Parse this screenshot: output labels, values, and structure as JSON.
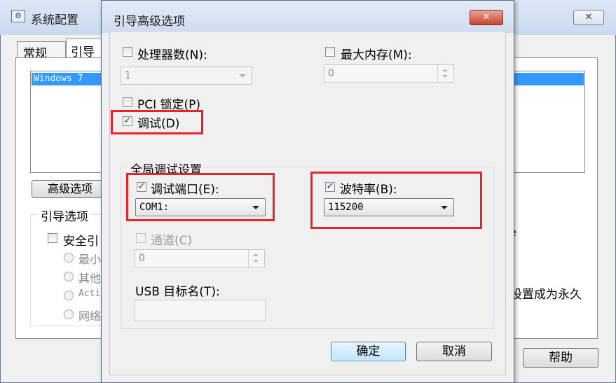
{
  "background_window": {
    "title": "系统配置",
    "close_label": "✕",
    "tabs": [
      "常规",
      "引导"
    ],
    "list_items": [
      "Windows 7"
    ],
    "advanced_button": "高级选项",
    "boot_options_group": "引导选项",
    "safe_boot_label": "安全引",
    "radio_labels": [
      "最小",
      "其他",
      "Acti",
      "网络"
    ],
    "right_fragment": "e",
    "right_text": "设置成为永久",
    "help_button": "帮助"
  },
  "dialog": {
    "title": "引导高级选项",
    "close_label": "✕",
    "processors": {
      "label": "处理器数(N):",
      "checked": false,
      "value": "1"
    },
    "max_memory": {
      "label": "最大内存(M):",
      "checked": false,
      "value": "0"
    },
    "pci_lock": {
      "label": "PCI 锁定(P)",
      "checked": false
    },
    "debug": {
      "label": "调试(D)",
      "checked": true
    },
    "global_debug_group": "全局调试设置",
    "debug_port": {
      "label": "调试端口(E):",
      "checked": true,
      "value": "COM1:"
    },
    "baud_rate": {
      "label": "波特率(B):",
      "checked": true,
      "value": "115200"
    },
    "channel": {
      "label": "通道(C)",
      "checked": false,
      "value": "0"
    },
    "usb_target": {
      "label": "USB 目标名(T):",
      "value": ""
    },
    "ok_button": "确定",
    "cancel_button": "取消",
    "check_mark": "✓"
  },
  "colors": {
    "highlight": "#e8242b",
    "close_button": "#c9452e",
    "selection": "#3399ff"
  }
}
